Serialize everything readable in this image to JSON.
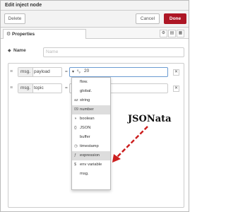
{
  "tray": {
    "title": "Edit inject node"
  },
  "toolbar": {
    "delete_label": "Delete",
    "cancel_label": "Cancel",
    "done_label": "Done"
  },
  "tabs": {
    "properties_label": "Properties"
  },
  "name_field": {
    "label": "Name",
    "placeholder": "Name"
  },
  "props": [
    {
      "type": "msg.",
      "key": "payload",
      "eq": "=",
      "value": "20"
    },
    {
      "type": "msg.",
      "key": "topic",
      "eq": "="
    }
  ],
  "dropdown": {
    "items": [
      {
        "icon": "",
        "label": "flow."
      },
      {
        "icon": "",
        "label": "global."
      },
      {
        "icon": "az",
        "label": "string"
      },
      {
        "icon": "09",
        "label": "number",
        "highlighted": true
      },
      {
        "icon": "◑",
        "label": "boolean"
      },
      {
        "icon": "{}",
        "label": "JSON"
      },
      {
        "icon": "",
        "label": "buffer"
      },
      {
        "icon": "◷",
        "label": "timestamp"
      },
      {
        "icon": "ƒ",
        "label": "expression",
        "highlighted": true
      },
      {
        "icon": "$",
        "label": "env variable"
      },
      {
        "icon": "",
        "label": "msg."
      }
    ]
  },
  "annotation": {
    "text": "JSONata",
    "color": "#cc1f1f"
  }
}
